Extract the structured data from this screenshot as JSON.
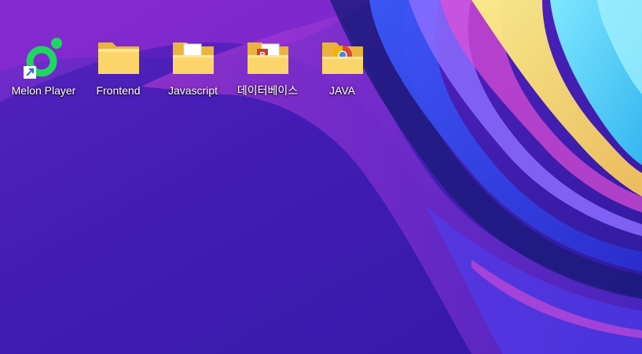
{
  "desktop": {
    "icons": [
      {
        "label": "Melon Player",
        "icon": "melon-player-icon",
        "shortcut": true
      },
      {
        "label": "Frontend",
        "icon": "folder-icon"
      },
      {
        "label": "Javascript",
        "icon": "folder-document-icon"
      },
      {
        "label": "데이터베이스",
        "icon": "folder-powerpoint-icon"
      },
      {
        "label": "JAVA",
        "icon": "folder-chrome-icon"
      }
    ]
  },
  "colors": {
    "melon_green": "#1ed760",
    "folder_yellow": "#f7c948",
    "folder_front": "#fde08a",
    "powerpoint_red": "#c84224",
    "label_text": "#ffffff"
  }
}
